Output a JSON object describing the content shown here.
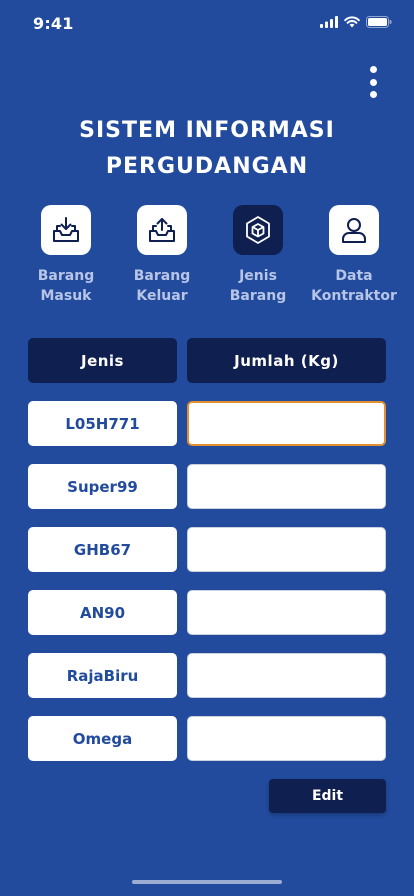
{
  "status": {
    "time": "9:41"
  },
  "title": {
    "line1": "SISTEM INFORMASI",
    "line2": "PERGUDANGAN"
  },
  "nav": [
    {
      "line1": "Barang",
      "line2": "Masuk",
      "icon": "inbox-download-icon",
      "active": false
    },
    {
      "line1": "Barang",
      "line2": "Keluar",
      "icon": "inbox-upload-icon",
      "active": false
    },
    {
      "line1": "Jenis",
      "line2": "Barang",
      "icon": "cube-icon",
      "active": true
    },
    {
      "line1": "Data",
      "line2": "Kontraktor",
      "icon": "user-icon",
      "active": false
    }
  ],
  "table": {
    "headers": {
      "jenis": "Jenis",
      "jumlah": "Jumlah (Kg)"
    },
    "rows": [
      {
        "jenis": "L05H771",
        "jumlah": ""
      },
      {
        "jenis": "Super99",
        "jumlah": ""
      },
      {
        "jenis": "GHB67",
        "jumlah": ""
      },
      {
        "jenis": "AN90",
        "jumlah": ""
      },
      {
        "jenis": "RajaBiru",
        "jumlah": ""
      },
      {
        "jenis": "Omega",
        "jumlah": ""
      }
    ]
  },
  "edit_button": {
    "label": "Edit"
  },
  "colors": {
    "background": "#224b9e",
    "dark": "#0f1f4f",
    "focus_border": "#e0902f"
  }
}
